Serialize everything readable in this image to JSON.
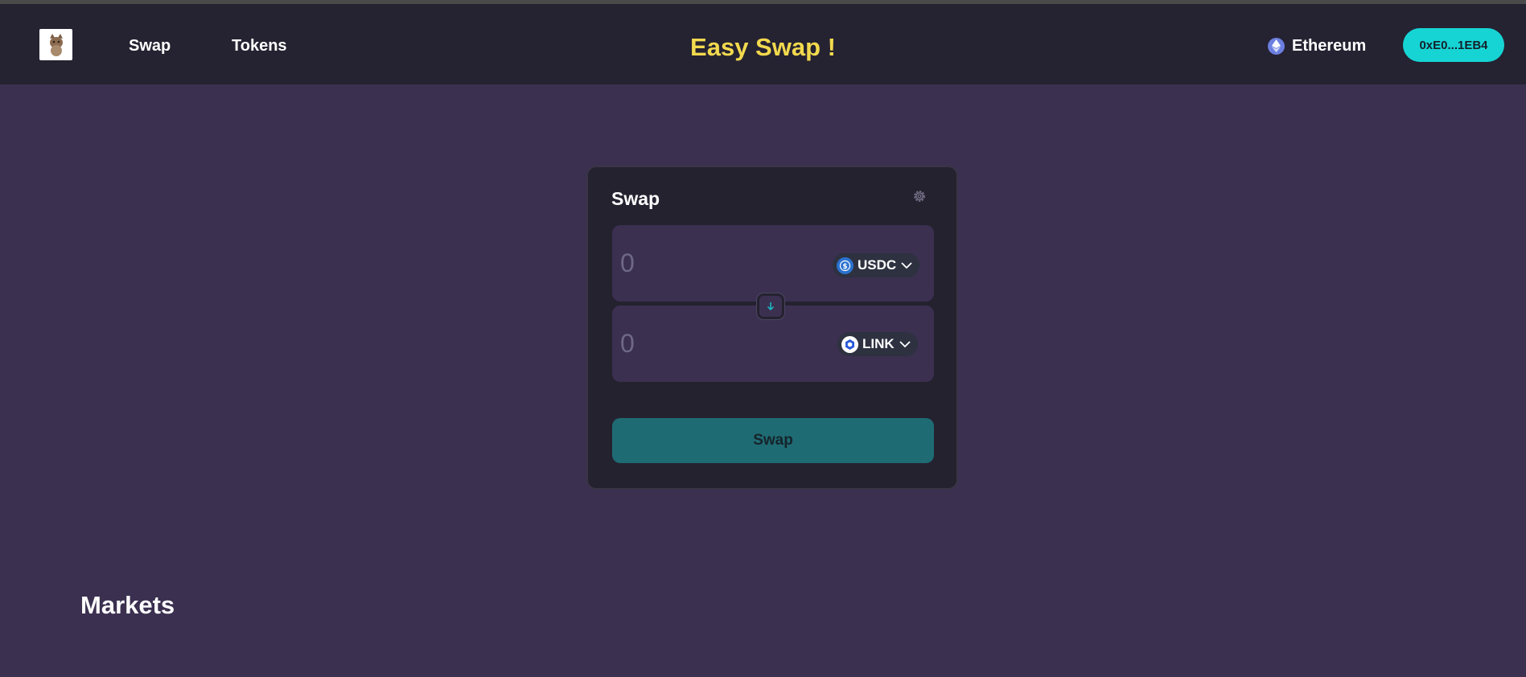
{
  "header": {
    "logo_icon": "cat-avatar-icon",
    "nav": [
      {
        "label": "Swap"
      },
      {
        "label": "Tokens"
      }
    ],
    "brand_title": "Easy Swap !",
    "network": {
      "label": "Ethereum",
      "icon": "ethereum-icon"
    },
    "wallet_label": "0xE0...1EB4"
  },
  "swap_card": {
    "title": "Swap",
    "settings_icon": "gear-icon",
    "from": {
      "amount_placeholder": "0",
      "token": "USDC",
      "token_icon": "usdc-icon"
    },
    "to": {
      "amount_placeholder": "0",
      "token": "LINK",
      "token_icon": "chainlink-icon"
    },
    "switch_icon": "arrow-down-icon",
    "action_label": "Swap"
  },
  "markets": {
    "title": "Markets"
  },
  "colors": {
    "background": "#3b3050",
    "header": "#252231",
    "brand": "#f2d94e",
    "accent": "#17d4d4",
    "swap_button": "#1f6b73"
  }
}
